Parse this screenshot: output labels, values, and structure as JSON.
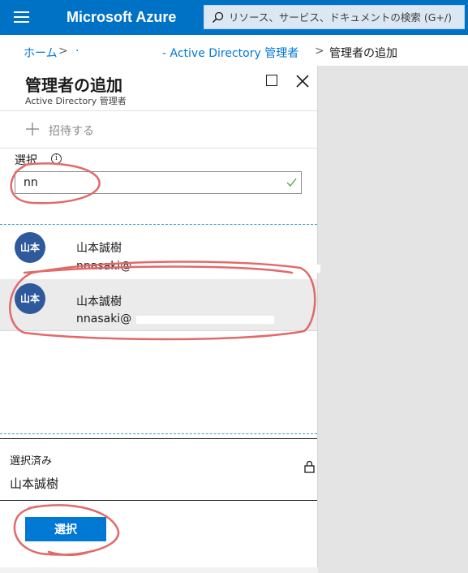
{
  "header": {
    "brand": "Microsoft Azure",
    "search_placeholder": "リソース、サービス、ドキュメントの検索 (G+/)"
  },
  "breadcrumb": {
    "home": "ホーム",
    "directory": "- Active Directory 管理者",
    "current": "管理者の追加"
  },
  "blade": {
    "title": "管理者の追加",
    "subtitle": "Active Directory 管理者",
    "invite_label": "招待する",
    "select_label": "選択",
    "filter_value": "nn",
    "users": [
      {
        "initials": "山本",
        "name": "山本誠樹",
        "email": "nnasaki@"
      },
      {
        "initials": "山本",
        "name": "山本誠樹",
        "email": "nnasaki@"
      }
    ],
    "selected_title": "選択済み",
    "selected_name": "山本誠樹",
    "select_button": "選択"
  },
  "colors": {
    "topbar": "#0072c6",
    "accent": "#0078d4",
    "avatar": "#2e5a9c",
    "annotation": "#e06a6a"
  }
}
